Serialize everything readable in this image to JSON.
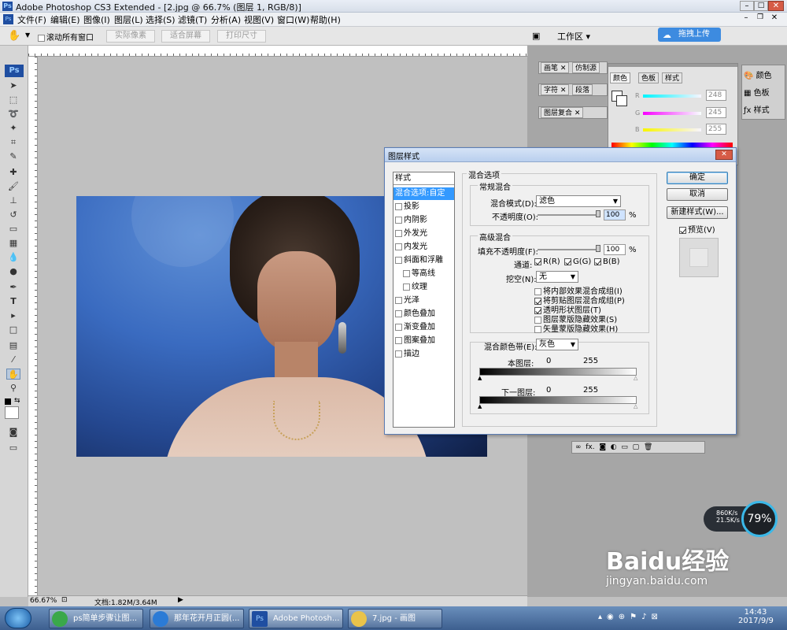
{
  "window": {
    "title": "Adobe Photoshop CS3 Extended - [2.jpg @ 66.7% (图层 1, RGB/8)]"
  },
  "menu": [
    "文件(F)",
    "编辑(E)",
    "图像(I)",
    "图层(L)",
    "选择(S)",
    "滤镜(T)",
    "分析(A)",
    "视图(V)",
    "窗口(W)",
    "帮助(H)"
  ],
  "options": {
    "scroll_all": "滚动所有窗口",
    "actual_pixels": "实际像素",
    "fit_screen": "适合屏幕",
    "print_size": "打印尺寸",
    "workspace": "工作区",
    "upload": "拖拽上传"
  },
  "status": {
    "zoom": "66.67%",
    "doc": "文档:1.82M/3.64M"
  },
  "panels": {
    "tabs_row1": [
      "画笔",
      "仿制源"
    ],
    "tabs_row2": [
      "字符",
      "段落"
    ],
    "tabs_row3": [
      "图层复合"
    ],
    "color_tabs": [
      "颜色",
      "色板",
      "样式"
    ],
    "sliders": [
      {
        "label": "R",
        "value": "248"
      },
      {
        "label": "G",
        "value": "245"
      },
      {
        "label": "B",
        "value": "255"
      }
    ],
    "dock": [
      "颜色",
      "色板",
      "样式"
    ]
  },
  "dialog": {
    "title": "图层样式",
    "styles_header": "样式",
    "styles": [
      {
        "label": "混合选项:自定",
        "selected": true,
        "checkbox": false
      },
      {
        "label": "投影",
        "checkbox": true
      },
      {
        "label": "内阴影",
        "checkbox": true
      },
      {
        "label": "外发光",
        "checkbox": true
      },
      {
        "label": "内发光",
        "checkbox": true
      },
      {
        "label": "斜面和浮雕",
        "checkbox": true
      },
      {
        "label": "等高线",
        "checkbox": true,
        "indent": true
      },
      {
        "label": "纹理",
        "checkbox": true,
        "indent": true
      },
      {
        "label": "光泽",
        "checkbox": true
      },
      {
        "label": "颜色叠加",
        "checkbox": true
      },
      {
        "label": "渐变叠加",
        "checkbox": true
      },
      {
        "label": "图案叠加",
        "checkbox": true
      },
      {
        "label": "描边",
        "checkbox": true
      }
    ],
    "blend_options": "混合选项",
    "general": "常规混合",
    "blend_mode_label": "混合模式(D):",
    "blend_mode": "滤色",
    "opacity_label": "不透明度(O):",
    "opacity": "100",
    "pct": "%",
    "advanced": "高级混合",
    "fill_label": "填充不透明度(F):",
    "fill": "100",
    "channels_label": "通道:",
    "ch_r": "R(R)",
    "ch_g": "G(G)",
    "ch_b": "B(B)",
    "knockout_label": "挖空(N):",
    "knockout": "无",
    "opt1": "将内部效果混合成组(I)",
    "opt2": "将剪贴图层混合成组(P)",
    "opt3": "透明形状图层(T)",
    "opt4": "图层蒙版隐藏效果(S)",
    "opt5": "矢量蒙版隐藏效果(H)",
    "blendif_label": "混合颜色带(E):",
    "blendif": "灰色",
    "this_layer": "本图层:",
    "underlying": "下一图层:",
    "v0": "0",
    "v255": "255",
    "ok": "确定",
    "cancel": "取消",
    "new_style": "新建样式(W)...",
    "preview": "预览(V)"
  },
  "net": {
    "down": "860K/s",
    "up": "21.5K/s",
    "pct": "79%"
  },
  "taskbar": {
    "items": [
      "ps简单步骤让图...",
      "那年花开月正圆(...",
      "Adobe Photosh...",
      "7.jpg - 画图"
    ],
    "time": "14:43",
    "date": "2017/9/9"
  },
  "watermark": {
    "brand": "Baidu经验",
    "url": "jingyan.baidu.com"
  },
  "colors": {
    "accent": "#3399ff",
    "bg": "#c0c0c0"
  }
}
